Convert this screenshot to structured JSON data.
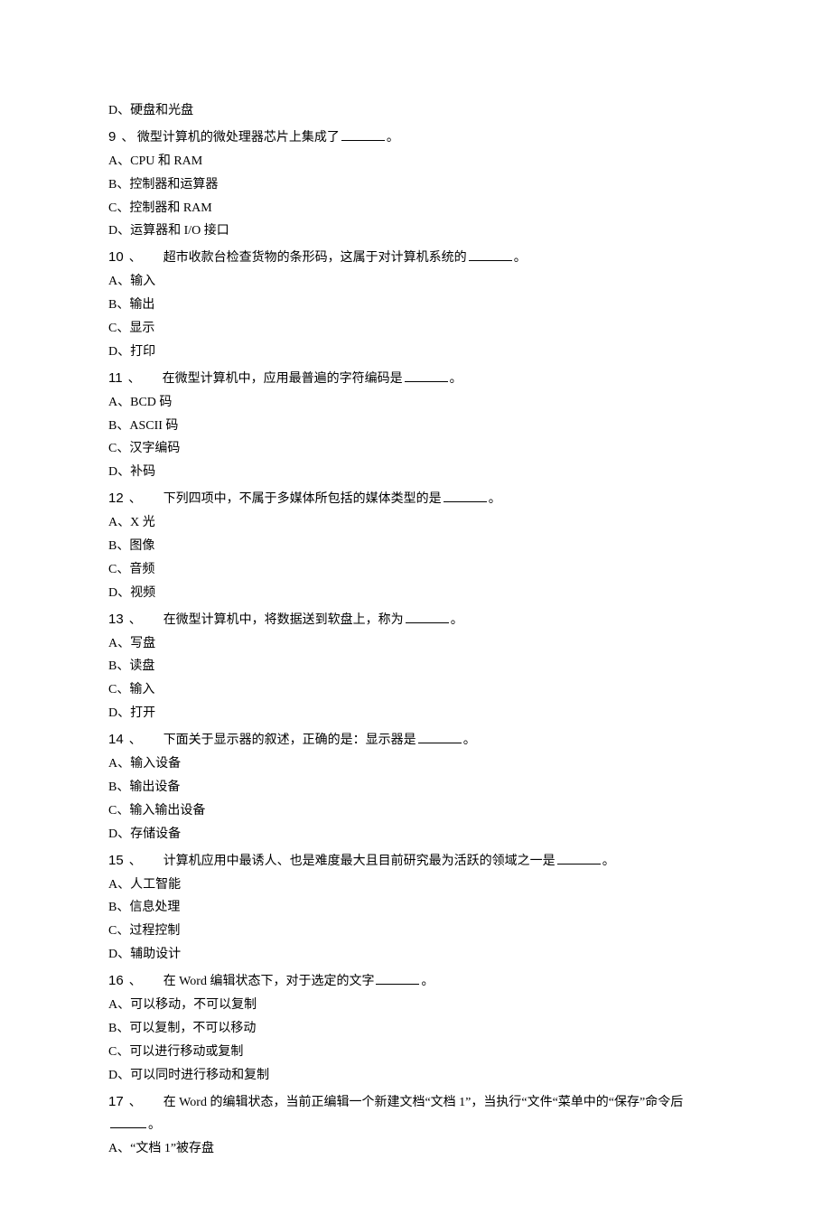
{
  "pre_option": "D、硬盘和光盘",
  "questions": [
    {
      "num": "9",
      "stem_pre": " 微型计算机的微处理器芯片上集成了",
      "stem_post": "。",
      "options": [
        "A、CPU 和 RAM",
        "B、控制器和运算器",
        "C、控制器和 RAM",
        "D、运算器和 I/O 接口"
      ]
    },
    {
      "num": "10",
      "stem_pre": "超市收款台检查货物的条形码，这属于对计算机系统的",
      "stem_post": "。",
      "options": [
        "A、输入",
        "B、输出",
        "C、显示",
        "D、打印"
      ]
    },
    {
      "num": "11",
      "stem_pre": "在微型计算机中，应用最普遍的字符编码是",
      "stem_post": "。",
      "options": [
        "A、BCD 码",
        "B、ASCII 码",
        "C、汉字编码",
        "D、补码"
      ]
    },
    {
      "num": "12",
      "stem_pre": "下列四项中，不属于多媒体所包括的媒体类型的是",
      "stem_post": "。",
      "options": [
        "A、X 光",
        "B、图像",
        "C、音频",
        "D、视频"
      ]
    },
    {
      "num": "13",
      "stem_pre": "在微型计算机中，将数据送到软盘上，称为",
      "stem_post": "。",
      "options": [
        "A、写盘",
        "B、读盘",
        "C、输入",
        "D、打开"
      ]
    },
    {
      "num": "14",
      "stem_pre": "下面关于显示器的叙述，正确的是：显示器是",
      "stem_post": "。",
      "options": [
        "A、输入设备",
        "B、输出设备",
        "C、输入输出设备",
        "D、存储设备"
      ]
    },
    {
      "num": "15",
      "stem_pre": "计算机应用中最诱人、也是难度最大且目前研究最为活跃的领域之一是",
      "stem_post": "。",
      "options": [
        "A、人工智能",
        "B、信息处理",
        "C、过程控制",
        "D、辅助设计"
      ]
    },
    {
      "num": "16",
      "stem_pre": "在 Word 编辑状态下，对于选定的文字",
      "stem_post": "。",
      "options": [
        "A、可以移动，不可以复制",
        "B、可以复制，不可以移动",
        "C、可以进行移动或复制",
        "D、可以同时进行移动和复制"
      ]
    },
    {
      "num": "17",
      "stem_pre": "在 Word 的编辑状态，当前正编辑一个新建文档“文档 1”，当执行“文件“菜单中的“保存”命令后",
      "stem_post": "。",
      "blank_on_newline": true,
      "options": [
        "A、“文档 1”被存盘"
      ]
    }
  ]
}
